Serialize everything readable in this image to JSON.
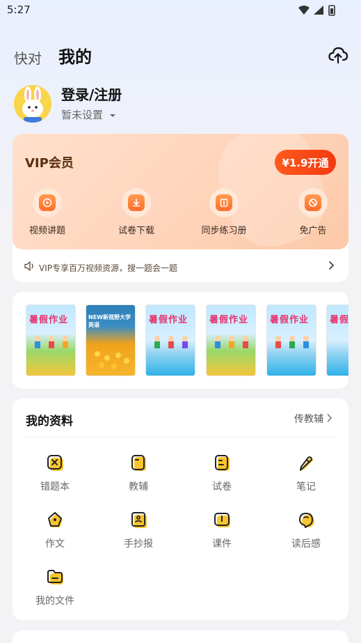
{
  "status": {
    "time": "5:27"
  },
  "header": {
    "tab_quick": "快对",
    "tab_mine": "我的"
  },
  "profile": {
    "login_title": "登录/注册",
    "subtitle": "暂未设置"
  },
  "vip": {
    "title": "VIP会员",
    "open_label": "¥1.9开通",
    "features": [
      {
        "label": "视频讲题",
        "icon": "video-play-icon"
      },
      {
        "label": "试卷下载",
        "icon": "download-icon"
      },
      {
        "label": "同步练习册",
        "icon": "book-icon"
      },
      {
        "label": "免广告",
        "icon": "no-ads-icon"
      }
    ],
    "note": "VIP专享百万视频资源，搜一题会一题"
  },
  "books": [
    {
      "title": "暑假作业",
      "style": "summer"
    },
    {
      "title": "NEW新视野大学英语",
      "style": "english"
    },
    {
      "title": "暑假作业",
      "style": "summer2"
    },
    {
      "title": "暑假作业",
      "style": "summer"
    },
    {
      "title": "暑假作业",
      "style": "summer2"
    },
    {
      "title": "暑假",
      "style": "summer2"
    }
  ],
  "materials": {
    "title": "我的资料",
    "link_label": "传教辅",
    "items": [
      {
        "label": "错题本",
        "icon": "wrong-book-icon"
      },
      {
        "label": "教辅",
        "icon": "guide-book-icon"
      },
      {
        "label": "试卷",
        "icon": "exam-paper-icon"
      },
      {
        "label": "笔记",
        "icon": "note-pen-icon"
      },
      {
        "label": "作文",
        "icon": "composition-icon"
      },
      {
        "label": "手抄报",
        "icon": "handwritten-paper-icon"
      },
      {
        "label": "课件",
        "icon": "courseware-icon"
      },
      {
        "label": "读后感",
        "icon": "reading-reflection-icon"
      },
      {
        "label": "我的文件",
        "icon": "folder-icon"
      }
    ]
  },
  "colors": {
    "accent": "#ff5a1e",
    "icon_yellow": "#f8c52f",
    "vip_bg": "#ffd6bf"
  }
}
